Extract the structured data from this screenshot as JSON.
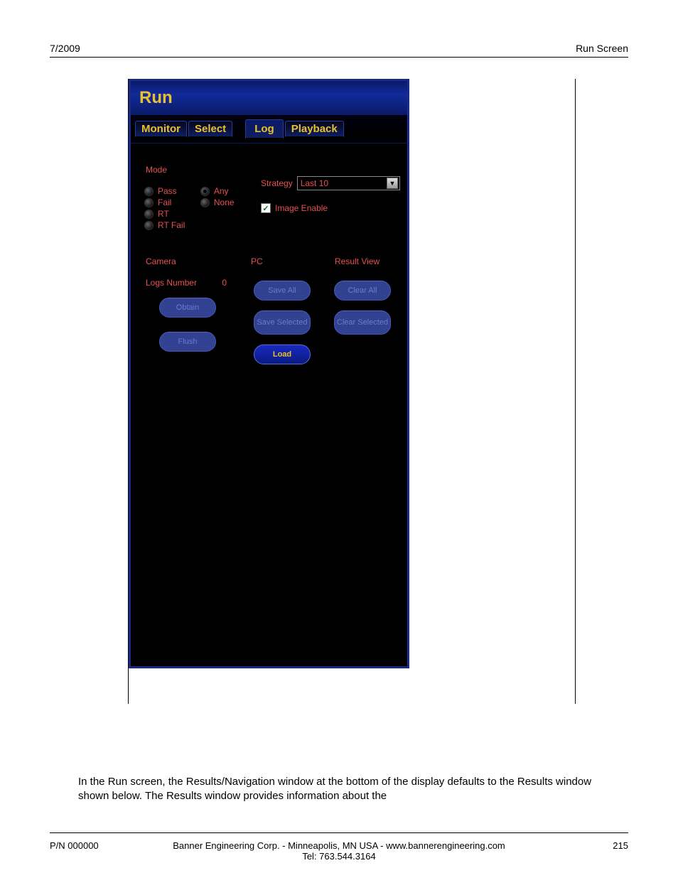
{
  "header": {
    "left": "7/2009",
    "right": "Run Screen"
  },
  "window": {
    "title": "Run",
    "tabs": [
      "Monitor",
      "Select",
      "Log",
      "Playback"
    ],
    "active_tab_index": 2
  },
  "mode": {
    "legend": "Mode",
    "col1": [
      "Pass",
      "Fail",
      "RT",
      "RT Fail"
    ],
    "col2": [
      "Any",
      "None"
    ],
    "selected": "Any"
  },
  "strategy": {
    "label": "Strategy",
    "value": "Last 10"
  },
  "image_enable": {
    "label": "Image Enable",
    "checked": true
  },
  "camera": {
    "legend": "Camera",
    "logs_label": "Logs Number",
    "logs_value": "0",
    "buttons": {
      "obtain": "Obtain",
      "flush": "Flush"
    }
  },
  "pc": {
    "legend": "PC",
    "buttons": {
      "save_all": "Save All",
      "save_selected": "Save Selected",
      "load": "Load"
    }
  },
  "result_view": {
    "legend": "Result View",
    "buttons": {
      "clear_all": "Clear All",
      "clear_selected": "Clear Selected"
    }
  },
  "body_text": "In the Run screen, the Results/Navigation window at the bottom of the display defaults to the Results window shown below. The Results window provides information about the",
  "footer": {
    "left": "P/N 000000",
    "center_line1": "Banner Engineering Corp. - Minneapolis, MN USA - www.bannerengineering.com",
    "center_line2": "Tel: 763.544.3164",
    "right": "215"
  }
}
